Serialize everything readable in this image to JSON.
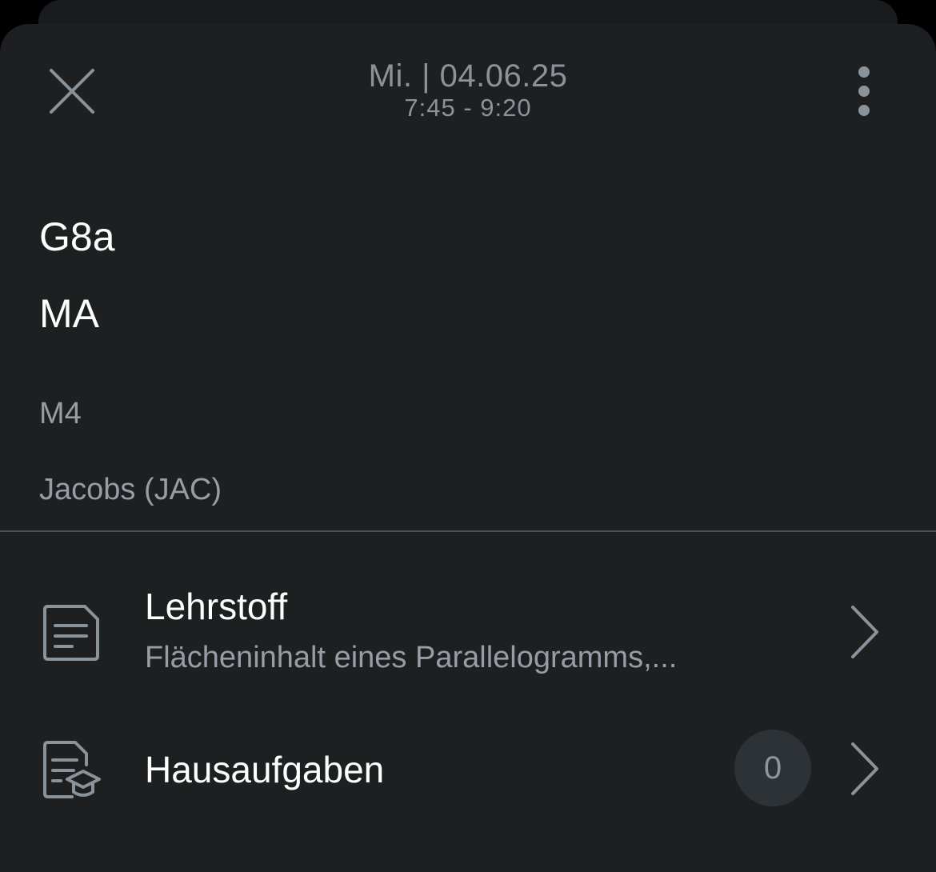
{
  "header": {
    "date": "Mi. | 04.06.25",
    "time": "7:45 - 9:20",
    "close_icon": "close-icon",
    "more_icon": "more-vertical-icon"
  },
  "lesson": {
    "class_name": "G8a",
    "subject": "MA",
    "room": "M4",
    "teacher": "Jacobs (JAC)"
  },
  "sections": {
    "lehrstoff": {
      "title": "Lehrstoff",
      "subtitle": "Flächeninhalt eines Parallelogramms,...",
      "icon": "document-icon"
    },
    "hausaufgaben": {
      "title": "Hausaufgaben",
      "count": "0",
      "icon": "homework-icon"
    }
  },
  "colors": {
    "background": "#1e1f21",
    "primary_text": "#ffffff",
    "secondary_text": "#969da4",
    "divider": "#46525a",
    "badge_bg": "#2c3236"
  }
}
